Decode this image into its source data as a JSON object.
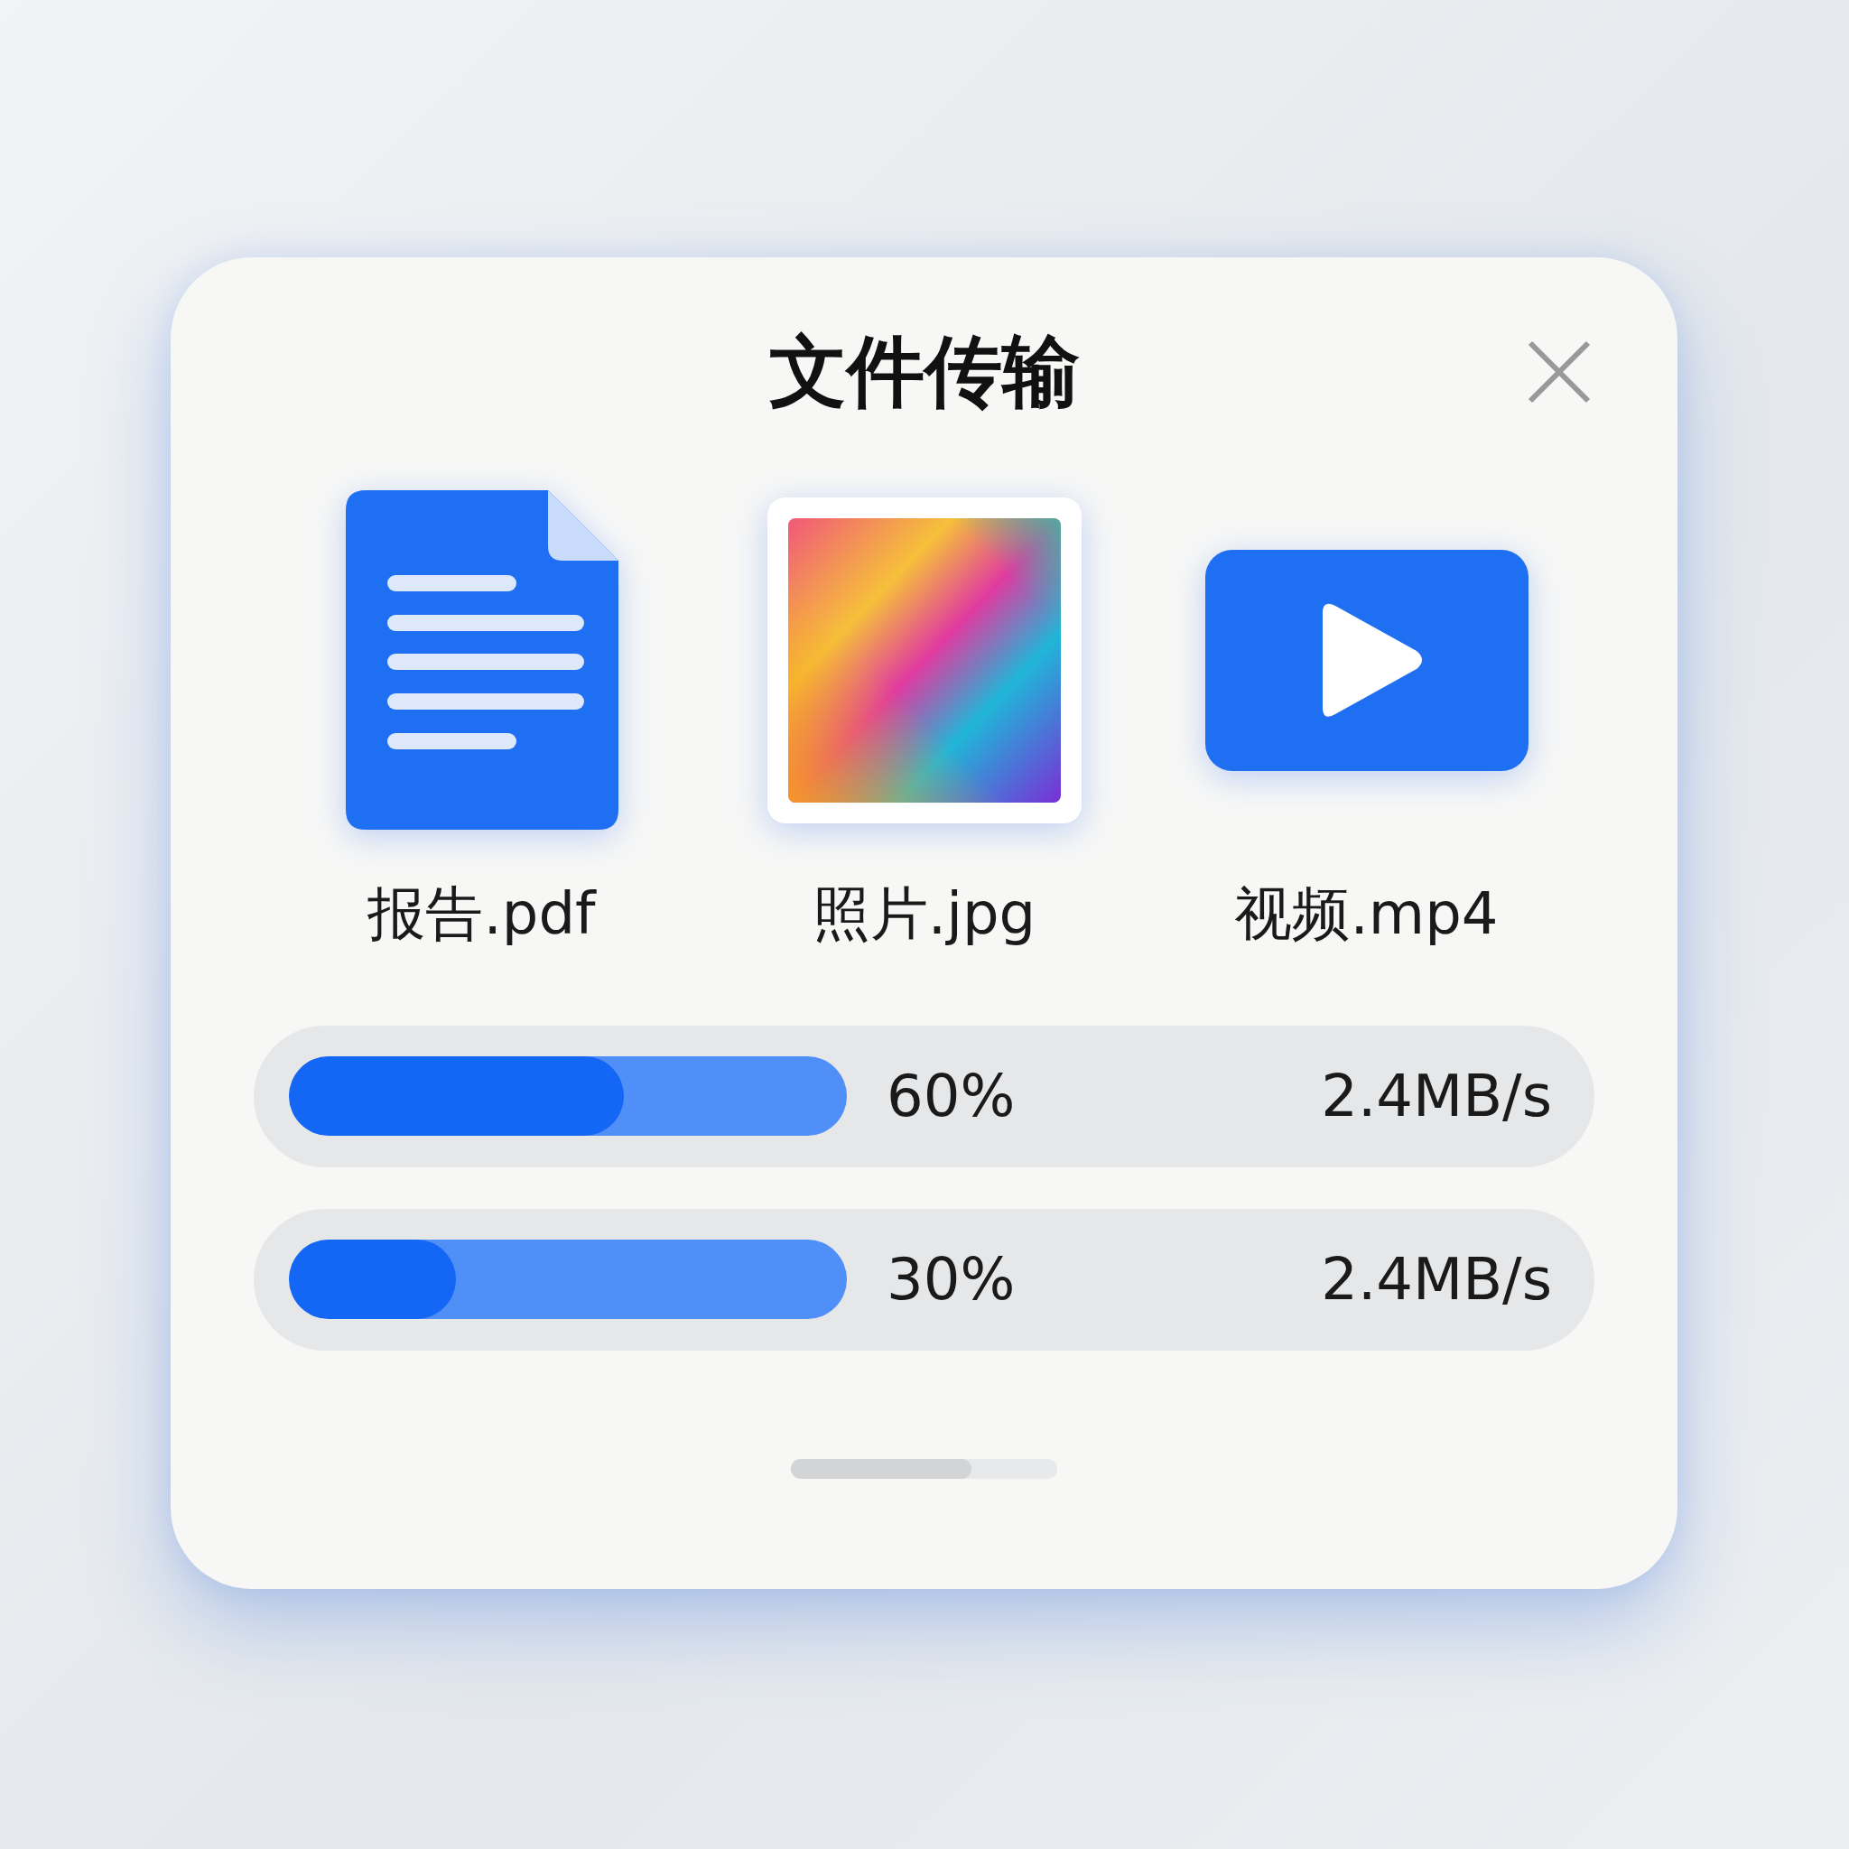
{
  "dialog": {
    "title": "文件传输"
  },
  "files": [
    {
      "name": "报告.pdf",
      "kind": "document"
    },
    {
      "name": "照片.jpg",
      "kind": "image"
    },
    {
      "name": "视频.mp4",
      "kind": "video"
    }
  ],
  "transfers": [
    {
      "level": 0.6,
      "percent": "60%",
      "speed": "2.4MB/s"
    },
    {
      "level": 0.3,
      "percent": "30%",
      "speed": "2.4MB/s"
    }
  ]
}
